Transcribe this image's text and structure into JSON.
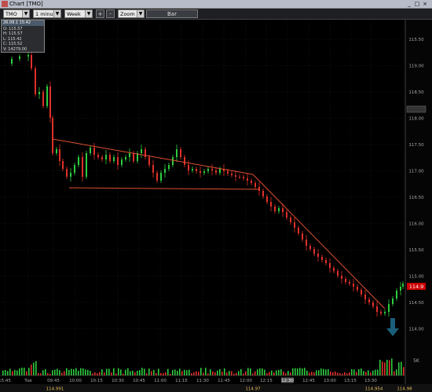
{
  "window": {
    "title": "Chart [TMO]",
    "controls": [
      "_",
      "□",
      "×"
    ]
  },
  "toolbar": {
    "symbol": "TMO",
    "interval": "1 minute",
    "range": "Week",
    "plus": "+",
    "minus": "-",
    "zoom": "Zoom",
    "bar": "Bar"
  },
  "ohlc_box": {
    "header": "26.09.1 15:42",
    "open": "O: 115.57",
    "high": "H: 115.57",
    "low": "L: 115.42",
    "close": "C: 115.52",
    "volume": "V: 14279.00"
  },
  "price_axis": {
    "labels": [
      "115.50",
      "119.00",
      "118.50",
      "118.00",
      "117.50",
      "117.00",
      "116.50",
      "116.00",
      "115.50",
      "115.00",
      "114.50",
      "114.00"
    ],
    "current_price": "114.9",
    "volume_label": "5K"
  },
  "time_axis": {
    "labels": [
      "15:45",
      "Tue",
      "09:45",
      "10:00",
      "10:15",
      "10:30",
      "10:45",
      "11:00",
      "11:15",
      "11:30",
      "11:45",
      "12:00",
      "12:15",
      "12:30",
      "12:45",
      "13:00",
      "13:15",
      "13:30"
    ],
    "highlight": "12:30"
  },
  "bottom_prices": [
    "114.991",
    "114.97",
    "114.954",
    "114.98"
  ],
  "colors": {
    "up": "#2ecc40",
    "down": "#e0302a",
    "trendline": "#e05030",
    "current_price_bg": "#cc0000"
  }
}
